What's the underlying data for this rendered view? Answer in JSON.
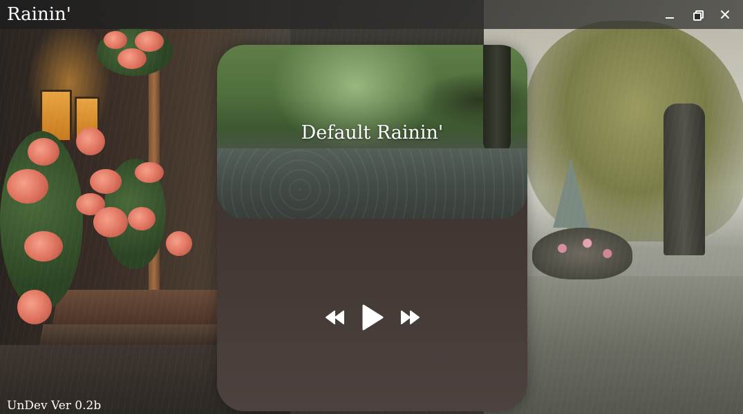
{
  "window": {
    "title": "Rainin'",
    "controls": {
      "minimize_icon": "minimize-icon",
      "restore_icon": "restore-icon",
      "close_icon": "close-icon"
    }
  },
  "player": {
    "track_title": "Default Rainin'",
    "controls": {
      "previous_icon": "rewind-icon",
      "play_icon": "play-icon",
      "next_icon": "fast-forward-icon"
    }
  },
  "footer": {
    "version": "UnDev Ver 0.2b"
  },
  "colors": {
    "text": "#ffffff",
    "titlebar": "#2b2a28",
    "player_panel": "#3f3430"
  }
}
